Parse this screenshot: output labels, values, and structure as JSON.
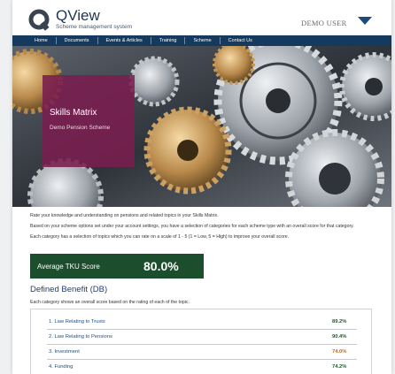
{
  "header": {
    "brand": "QView",
    "tagline": "Scheme management system",
    "user": "DEMO USER",
    "logo_icon": "q-logo-icon",
    "menu_icon": "chevron-down-icon"
  },
  "nav": {
    "items": [
      "Home",
      "Documents",
      "Events & Articles",
      "Training",
      "Scheme",
      "Contact Us"
    ]
  },
  "hero": {
    "title": "Skills Matrix",
    "subtitle": "Demo Pension Scheme"
  },
  "intro": {
    "lines": [
      "Rate your knowledge and understanding on pensions and related topics in your Skills Matrix.",
      "Based on your scheme options set under your account settings, you have a selection of categories for each scheme type with an overall score for that category.",
      "Each category has a selection of topics which you can rate on a scale of 1 - 5 (1 = Low, 5 = High) to improve your overall score."
    ]
  },
  "score": {
    "label": "Average TKU Score",
    "value": "80.0%"
  },
  "section": {
    "title": "Defined Benefit (DB)",
    "description": "Each category shows an overall score based on the rating of each of the topic.",
    "rows": [
      {
        "label": "1. Law Relating to Trusts",
        "score": "89.2%",
        "color": "#1c5a2e"
      },
      {
        "label": "2. Law Relating to Pensions",
        "score": "90.4%",
        "color": "#1c5a2e"
      },
      {
        "label": "3. Investment",
        "score": "74.0%",
        "color": "#c46a1a"
      },
      {
        "label": "4. Funding",
        "score": "74.2%",
        "color": "#1c5a2e"
      }
    ]
  },
  "colors": {
    "nav": "#153a5e",
    "card": "#7a1e4e",
    "score_bg": "#1c4d2c"
  }
}
